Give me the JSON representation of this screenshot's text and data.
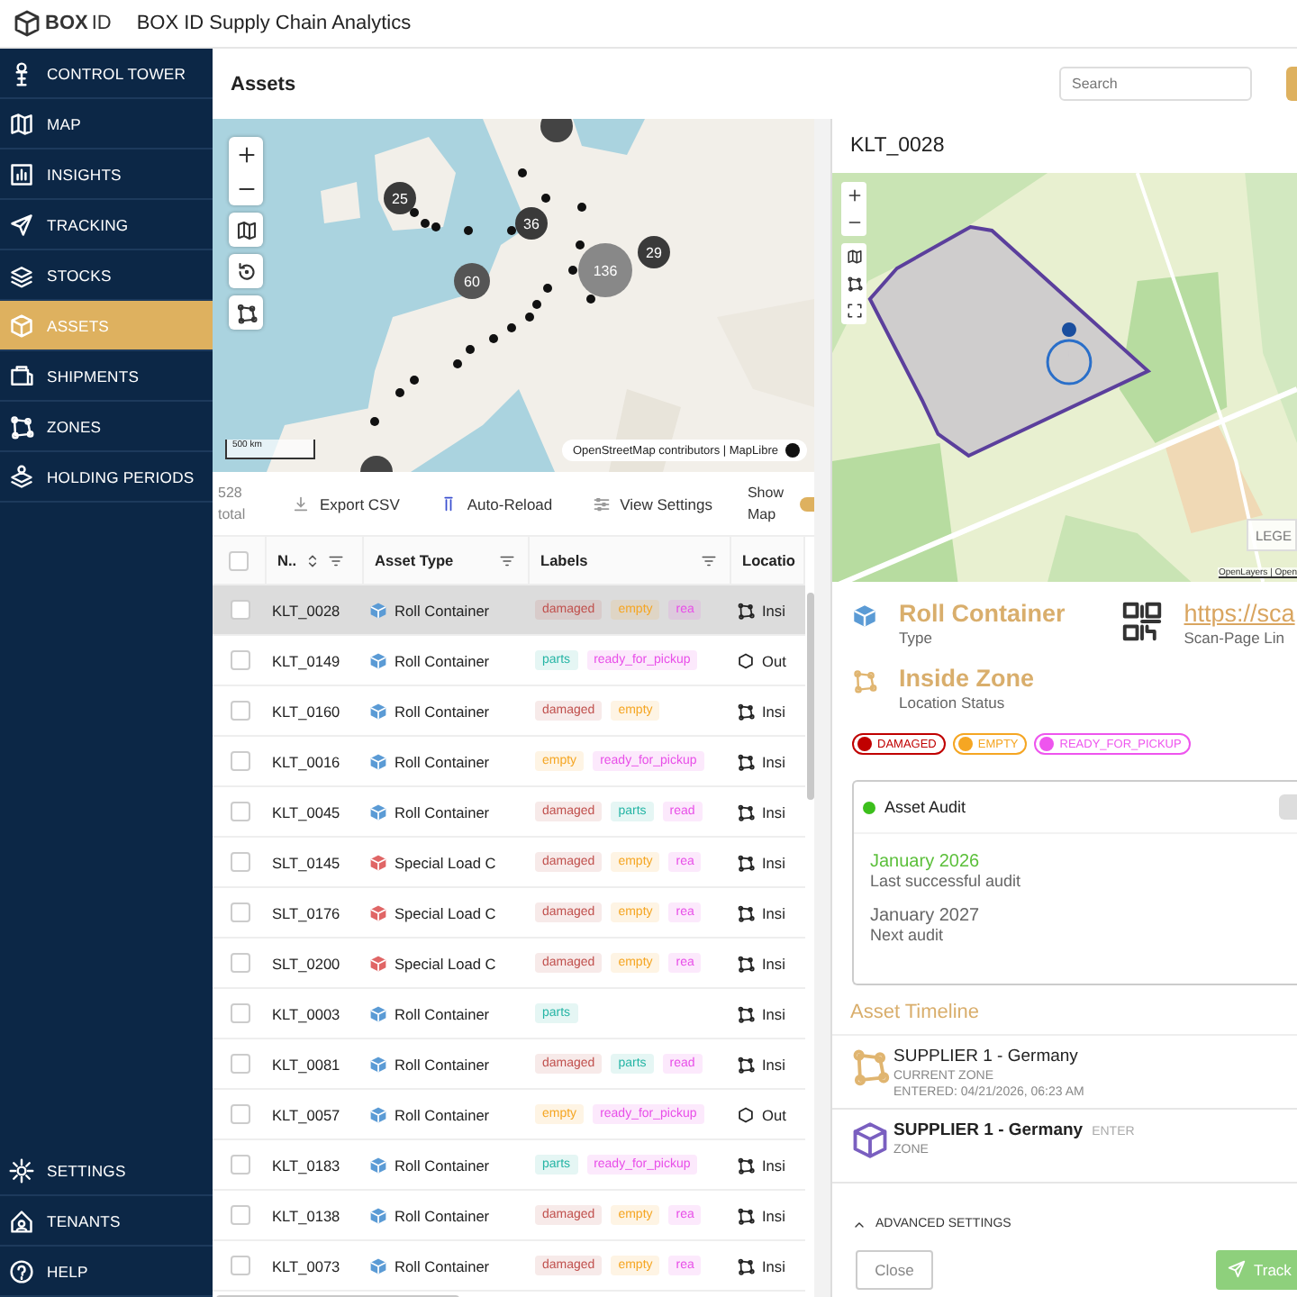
{
  "header": {
    "logo_bold": "BOX",
    "logo_light": "ID",
    "title": "BOX ID Supply Chain Analytics"
  },
  "sidebar": {
    "items": [
      {
        "label": "CONTROL TOWER",
        "selected": false
      },
      {
        "label": "MAP",
        "selected": false
      },
      {
        "label": "INSIGHTS",
        "selected": false
      },
      {
        "label": "TRACKING",
        "selected": false
      },
      {
        "label": "STOCKS",
        "selected": false
      },
      {
        "label": "ASSETS",
        "selected": true
      },
      {
        "label": "SHIPMENTS",
        "selected": false
      },
      {
        "label": "ZONES",
        "selected": false
      },
      {
        "label": "HOLDING PERIODS",
        "selected": false
      }
    ],
    "bottom_items": [
      {
        "label": "SETTINGS",
        "selected": false
      },
      {
        "label": "TENANTS",
        "selected": false
      },
      {
        "label": "HELP",
        "selected": false
      }
    ]
  },
  "page": {
    "title": "Assets",
    "search": {
      "placeholder": "Search"
    }
  },
  "map": {
    "clusters": [
      "25",
      "36",
      "60",
      "136",
      "29"
    ],
    "scale": "500 km",
    "attribution": "OpenStreetMap contributors | MapLibre"
  },
  "toolbar": {
    "count": "528",
    "count_label": "total",
    "actions": [
      "Export CSV",
      "Auto-Reload",
      "View Settings"
    ],
    "show_map": {
      "label": "Show Map",
      "on": true
    }
  },
  "table": {
    "select_all_checked": false,
    "columns": [
      "N..",
      "Asset Type",
      "Labels",
      "Locatio"
    ],
    "rows": [
      {
        "id": "KLT_0028",
        "type": "Roll Container",
        "kind": "roll",
        "labels": [
          {
            "text": "damaged",
            "color": "#c0504d"
          },
          {
            "text": "empty",
            "color": "#f5a623"
          },
          {
            "text": "rea",
            "color": "#e84ee8"
          }
        ],
        "location": {
          "text": "Insi",
          "kind": "inside"
        },
        "selected": true,
        "checked": false
      },
      {
        "id": "KLT_0149",
        "type": "Roll Container",
        "kind": "roll",
        "labels": [
          {
            "text": "parts",
            "color": "#26b5a5"
          },
          {
            "text": "ready_for_pickup",
            "color": "#e84ee8"
          }
        ],
        "location": {
          "text": "Out",
          "kind": "outside"
        },
        "selected": false,
        "checked": false
      },
      {
        "id": "KLT_0160",
        "type": "Roll Container",
        "kind": "roll",
        "labels": [
          {
            "text": "damaged",
            "color": "#c0504d"
          },
          {
            "text": "empty",
            "color": "#f5a623"
          }
        ],
        "location": {
          "text": "Insi",
          "kind": "inside"
        },
        "selected": false,
        "checked": false
      },
      {
        "id": "KLT_0016",
        "type": "Roll Container",
        "kind": "roll",
        "labels": [
          {
            "text": "empty",
            "color": "#f5a623"
          },
          {
            "text": "ready_for_pickup",
            "color": "#e84ee8"
          }
        ],
        "location": {
          "text": "Insi",
          "kind": "inside"
        },
        "selected": false,
        "checked": false
      },
      {
        "id": "KLT_0045",
        "type": "Roll Container",
        "kind": "roll",
        "labels": [
          {
            "text": "damaged",
            "color": "#c0504d"
          },
          {
            "text": "parts",
            "color": "#26b5a5"
          },
          {
            "text": "read",
            "color": "#e84ee8"
          }
        ],
        "location": {
          "text": "Insi",
          "kind": "inside"
        },
        "selected": false,
        "checked": false
      },
      {
        "id": "SLT_0145",
        "type": "Special Load C",
        "kind": "special",
        "labels": [
          {
            "text": "damaged",
            "color": "#c0504d"
          },
          {
            "text": "empty",
            "color": "#f5a623"
          },
          {
            "text": "rea",
            "color": "#e84ee8"
          }
        ],
        "location": {
          "text": "Insi",
          "kind": "inside"
        },
        "selected": false,
        "checked": false
      },
      {
        "id": "SLT_0176",
        "type": "Special Load C",
        "kind": "special",
        "labels": [
          {
            "text": "damaged",
            "color": "#c0504d"
          },
          {
            "text": "empty",
            "color": "#f5a623"
          },
          {
            "text": "rea",
            "color": "#e84ee8"
          }
        ],
        "location": {
          "text": "Insi",
          "kind": "inside"
        },
        "selected": false,
        "checked": false
      },
      {
        "id": "SLT_0200",
        "type": "Special Load C",
        "kind": "special",
        "labels": [
          {
            "text": "damaged",
            "color": "#c0504d"
          },
          {
            "text": "empty",
            "color": "#f5a623"
          },
          {
            "text": "rea",
            "color": "#e84ee8"
          }
        ],
        "location": {
          "text": "Insi",
          "kind": "inside"
        },
        "selected": false,
        "checked": false
      },
      {
        "id": "KLT_0003",
        "type": "Roll Container",
        "kind": "roll",
        "labels": [
          {
            "text": "parts",
            "color": "#26b5a5"
          }
        ],
        "location": {
          "text": "Insi",
          "kind": "inside"
        },
        "selected": false,
        "checked": false
      },
      {
        "id": "KLT_0081",
        "type": "Roll Container",
        "kind": "roll",
        "labels": [
          {
            "text": "damaged",
            "color": "#c0504d"
          },
          {
            "text": "parts",
            "color": "#26b5a5"
          },
          {
            "text": "read",
            "color": "#e84ee8"
          }
        ],
        "location": {
          "text": "Insi",
          "kind": "inside"
        },
        "selected": false,
        "checked": false
      },
      {
        "id": "KLT_0057",
        "type": "Roll Container",
        "kind": "roll",
        "labels": [
          {
            "text": "empty",
            "color": "#f5a623"
          },
          {
            "text": "ready_for_pickup",
            "color": "#e84ee8"
          }
        ],
        "location": {
          "text": "Out",
          "kind": "outside"
        },
        "selected": false,
        "checked": false
      },
      {
        "id": "KLT_0183",
        "type": "Roll Container",
        "kind": "roll",
        "labels": [
          {
            "text": "parts",
            "color": "#26b5a5"
          },
          {
            "text": "ready_for_pickup",
            "color": "#e84ee8"
          }
        ],
        "location": {
          "text": "Insi",
          "kind": "inside"
        },
        "selected": false,
        "checked": false
      },
      {
        "id": "KLT_0138",
        "type": "Roll Container",
        "kind": "roll",
        "labels": [
          {
            "text": "damaged",
            "color": "#c0504d"
          },
          {
            "text": "empty",
            "color": "#f5a623"
          },
          {
            "text": "rea",
            "color": "#e84ee8"
          }
        ],
        "location": {
          "text": "Insi",
          "kind": "inside"
        },
        "selected": false,
        "checked": false
      },
      {
        "id": "KLT_0073",
        "type": "Roll Container",
        "kind": "roll",
        "labels": [
          {
            "text": "damaged",
            "color": "#c0504d"
          },
          {
            "text": "empty",
            "color": "#f5a623"
          },
          {
            "text": "rea",
            "color": "#e84ee8"
          }
        ],
        "location": {
          "text": "Insi",
          "kind": "inside"
        },
        "selected": false,
        "checked": false
      }
    ]
  },
  "detail": {
    "title": "KLT_0028",
    "map": {
      "legend": "LEGE",
      "attribution": "OpenLayers | Open"
    },
    "type": {
      "value": "Roll Container",
      "label": "Type"
    },
    "scan": {
      "link": "https://sca",
      "label": "Scan-Page Lin"
    },
    "location": {
      "value": "Inside Zone",
      "label": "Location Status"
    },
    "chips": [
      {
        "text": "DAMAGED",
        "color": "#c00000"
      },
      {
        "text": "EMPTY",
        "color": "#f5a623"
      },
      {
        "text": "READY_FOR_PICKUP",
        "color": "#ee55ee"
      }
    ],
    "audit": {
      "title": "Asset Audit",
      "last_date": "January 2026",
      "last_label": "Last successful audit",
      "next_date": "January 2027",
      "next_label": "Next audit"
    },
    "timeline": {
      "title": "Asset Timeline",
      "entries": [
        {
          "kind": "zone",
          "title": "SUPPLIER 1 - Germany",
          "subtitle": "CURRENT ZONE",
          "detail": "ENTERED: 04/21/2026, 06:23 AM"
        },
        {
          "kind": "event",
          "title": "SUPPLIER 1 - Germany",
          "tag": "ENTER",
          "subtitle": "ZONE"
        }
      ]
    },
    "advanced": {
      "label": "ADVANCED SETTINGS"
    },
    "buttons": {
      "close": "Close",
      "track": "Track"
    }
  }
}
